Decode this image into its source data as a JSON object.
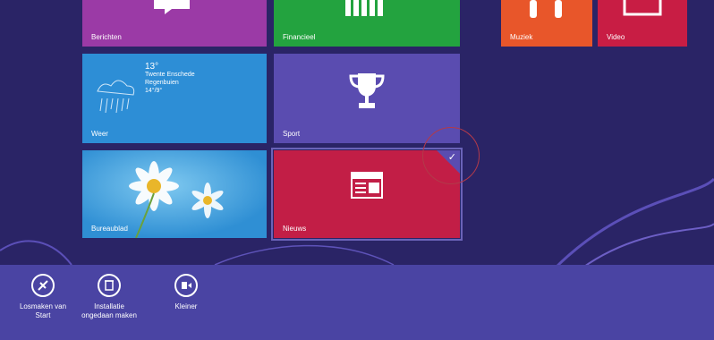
{
  "tiles": {
    "berichten": "Berichten",
    "financieel": "Financieel",
    "muziek": "Muziek",
    "video": "Video",
    "weer": "Weer",
    "sport": "Sport",
    "bureaublad": "Bureaublad",
    "nieuws": "Nieuws"
  },
  "weather": {
    "temp": "13°",
    "line1": "Twente Enschede",
    "line2": "Regenbuien",
    "line3": "14°/9°"
  },
  "appbar": {
    "unpin": "Losmaken van\nStart",
    "uninstall": "Installatie\nongedaan maken",
    "smaller": "Kleiner"
  },
  "selected_tile": "Nieuws",
  "colors": {
    "background": "#2a2466",
    "appbar": "#4a44a3",
    "selected_tile": "#c21e46"
  }
}
